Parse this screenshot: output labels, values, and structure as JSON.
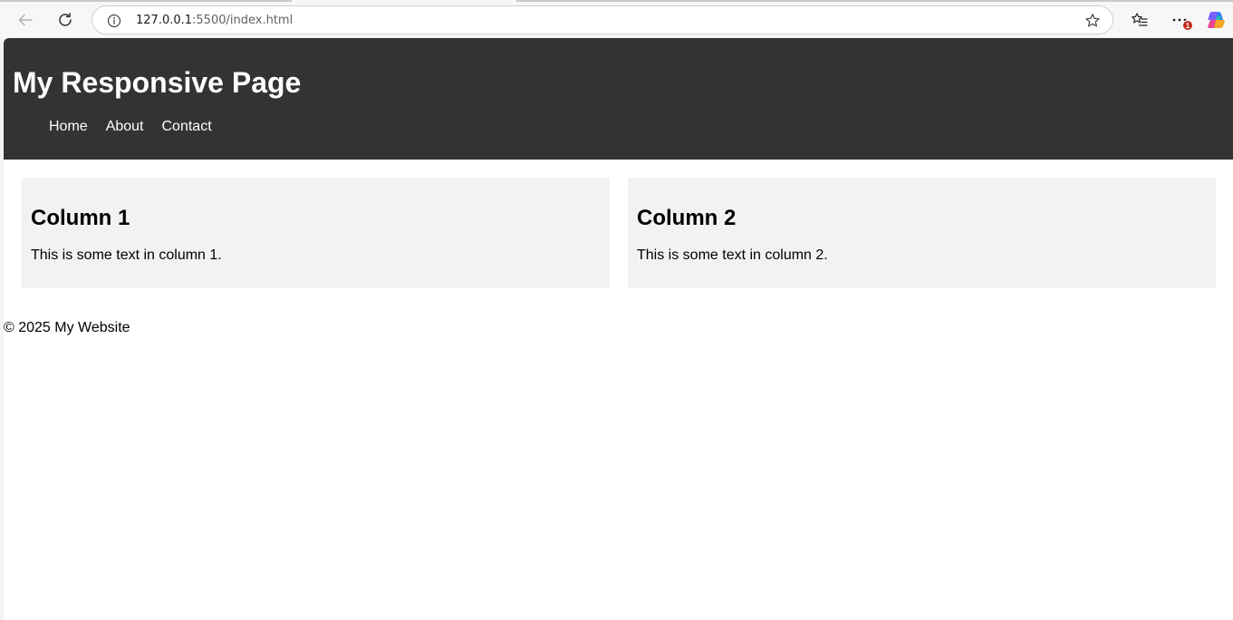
{
  "browser": {
    "url_host": "127.0.0.1",
    "url_path": ":5500/index.html",
    "notification_count": "1",
    "icons": {
      "back": "back-arrow-icon",
      "reload": "reload-icon",
      "site_info": "info-icon",
      "favorite": "star-icon",
      "favorites_list": "favorites-icon",
      "more": "more-dots-icon",
      "copilot": "copilot-icon"
    }
  },
  "page": {
    "title": "My Responsive Page",
    "nav": [
      "Home",
      "About",
      "Contact"
    ],
    "columns": [
      {
        "heading": "Column 1",
        "text": "This is some text in column 1."
      },
      {
        "heading": "Column 2",
        "text": "This is some text in column 2."
      }
    ],
    "footer": "© 2025 My Website",
    "colors": {
      "header_bg": "#333333",
      "column_bg": "#f2f2f2",
      "page_bg": "#ffffff"
    }
  }
}
